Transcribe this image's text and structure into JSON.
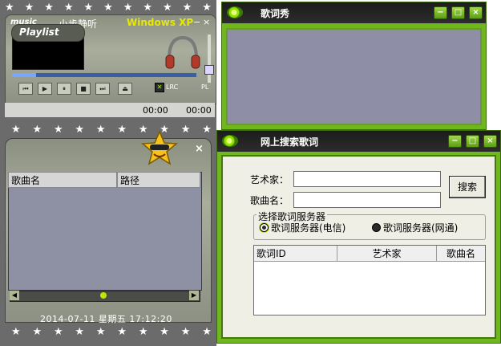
{
  "player": {
    "logo": "music",
    "song_title": "小步静听",
    "skin_name": "Windows XP",
    "minimize": "−",
    "close": "×",
    "lrc_label": "LRC",
    "pl_label": "PL",
    "time_elapsed": "00:00",
    "time_total": "00:00",
    "controls": [
      "prev",
      "play",
      "pause",
      "stop",
      "next",
      "eject"
    ]
  },
  "playlist": {
    "title": "Playlist",
    "close": "×",
    "columns": [
      "歌曲名",
      "路径"
    ],
    "datetime": "2014-07-11 星期五 17:12:20"
  },
  "lyric_show": {
    "title": "歌词秀",
    "buttons": [
      "−",
      "□",
      "×"
    ]
  },
  "search": {
    "title": "网上搜索歌词",
    "buttons": [
      "−",
      "□",
      "×"
    ],
    "artist_label": "艺术家：",
    "song_label": "歌曲名：",
    "artist_value": "",
    "song_value": "",
    "search_button": "搜索",
    "group_label": "选择歌词服务器",
    "server_telecom": "歌词服务器(电信)",
    "server_netcom": "歌词服务器(网通)",
    "selected_server": "telecom",
    "result_columns": [
      "歌词ID",
      "艺术家",
      "歌曲名"
    ]
  },
  "colors": {
    "window_green": "#6fb81c",
    "title_black": "#1c1c1c",
    "lyric_bg": "#8e8fa6",
    "list_bg": "#8e91a4"
  }
}
